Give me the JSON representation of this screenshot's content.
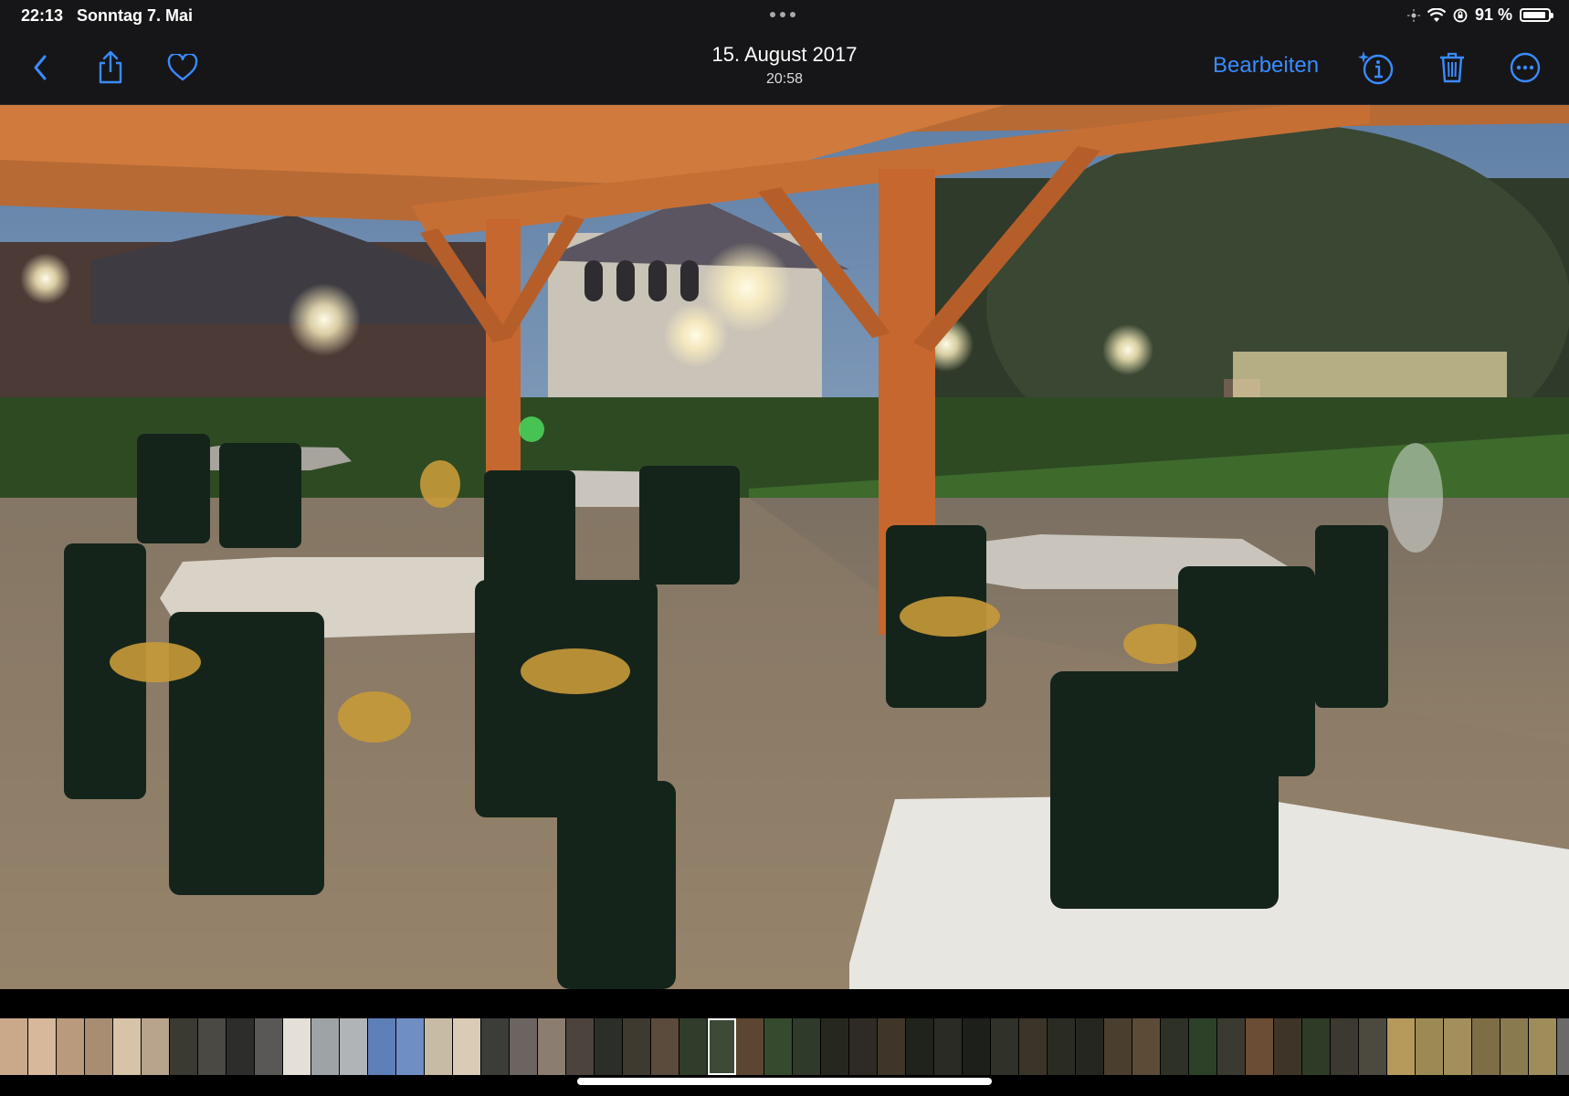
{
  "status_bar": {
    "time": "22:13",
    "date": "Sonntag 7. Mai",
    "battery_text": "91 %",
    "battery_level": 0.91
  },
  "toolbar": {
    "date": "15. August 2017",
    "time": "20:58",
    "edit_label": "Bearbeiten"
  },
  "icons": [
    "back-chevron-icon",
    "share-icon",
    "favorite-heart-icon",
    "info-sparkle-icon",
    "trash-icon",
    "more-icon"
  ],
  "accent_color": "#3a8bff",
  "filmstrip": {
    "thumb_colors": [
      "#c9a98a",
      "#d7b89a",
      "#b99a7d",
      "#a98d72",
      "#d6c3a8",
      "#b8a48d",
      "#3b3a32",
      "#4a4944",
      "#2d2d2b",
      "#5a5857",
      "#e4e0d8",
      "#9ea3a6",
      "#b1b4b6",
      "#5e80b8",
      "#6f8fc4",
      "#c8bba5",
      "#d9cbb5",
      "#3c3c38",
      "#6b6460",
      "#8b7e70",
      "#4c443c",
      "#2b2f27",
      "#3e3a30",
      "#5a4b3c",
      "#2f3d2a",
      "#3c4a36",
      "#5c4632",
      "#364a2e",
      "#2f3a2a",
      "#26281f",
      "#2f2b24",
      "#3f3629",
      "#20231c",
      "#2b2b26",
      "#1d1f1a",
      "#30322a",
      "#3a3528",
      "#2a2c24",
      "#262620",
      "#4a3e2e",
      "#5b4b37",
      "#2e3226",
      "#2d4128",
      "#3b3a31",
      "#6a4d34",
      "#3f3428",
      "#2e3b27",
      "#3b3930",
      "#4c4a3f",
      "#b59a5b",
      "#9c8a55",
      "#a38f5c",
      "#7f6d46",
      "#8a7a50",
      "#9e8c5a",
      "#6a6a6a"
    ],
    "selected_index": 25
  }
}
